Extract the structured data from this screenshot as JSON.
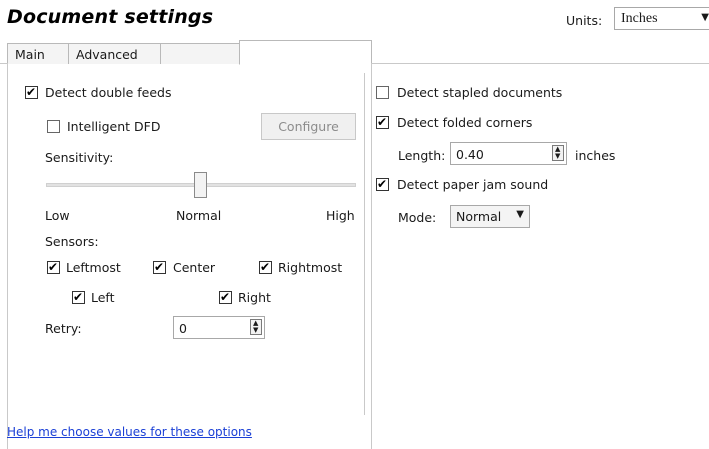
{
  "header": {
    "title": "Document settings",
    "units_label": "Units:",
    "units_value": "Inches"
  },
  "tabs": [
    {
      "label": "Main"
    },
    {
      "label": "Advanced"
    },
    {
      "label": ""
    },
    {
      "label": ""
    }
  ],
  "left": {
    "detect_double_feeds": {
      "label": "Detect double feeds",
      "checked": true
    },
    "intelligent_dfd": {
      "label": "Intelligent DFD",
      "checked": false
    },
    "configure_button": "Configure",
    "sensitivity_label": "Sensitivity:",
    "slider": {
      "low": "Low",
      "normal": "Normal",
      "high": "High",
      "level": 0.5
    },
    "sensors_label": "Sensors:",
    "sensors": {
      "leftmost": {
        "label": "Leftmost",
        "checked": true
      },
      "center": {
        "label": "Center",
        "checked": true
      },
      "rightmost": {
        "label": "Rightmost",
        "checked": true
      },
      "left": {
        "label": "Left",
        "checked": true
      },
      "right": {
        "label": "Right",
        "checked": true
      }
    },
    "retry_label": "Retry:",
    "retry_value": "0"
  },
  "right": {
    "detect_stapled": {
      "label": "Detect stapled documents",
      "checked": false
    },
    "detect_folded": {
      "label": "Detect folded corners",
      "checked": true
    },
    "length_label": "Length:",
    "length_value": "0.40",
    "length_unit": "inches",
    "detect_jam_sound": {
      "label": "Detect paper jam sound",
      "checked": true
    },
    "mode_label": "Mode:",
    "mode_value": "Normal"
  },
  "help_link": "Help me choose values for these options"
}
